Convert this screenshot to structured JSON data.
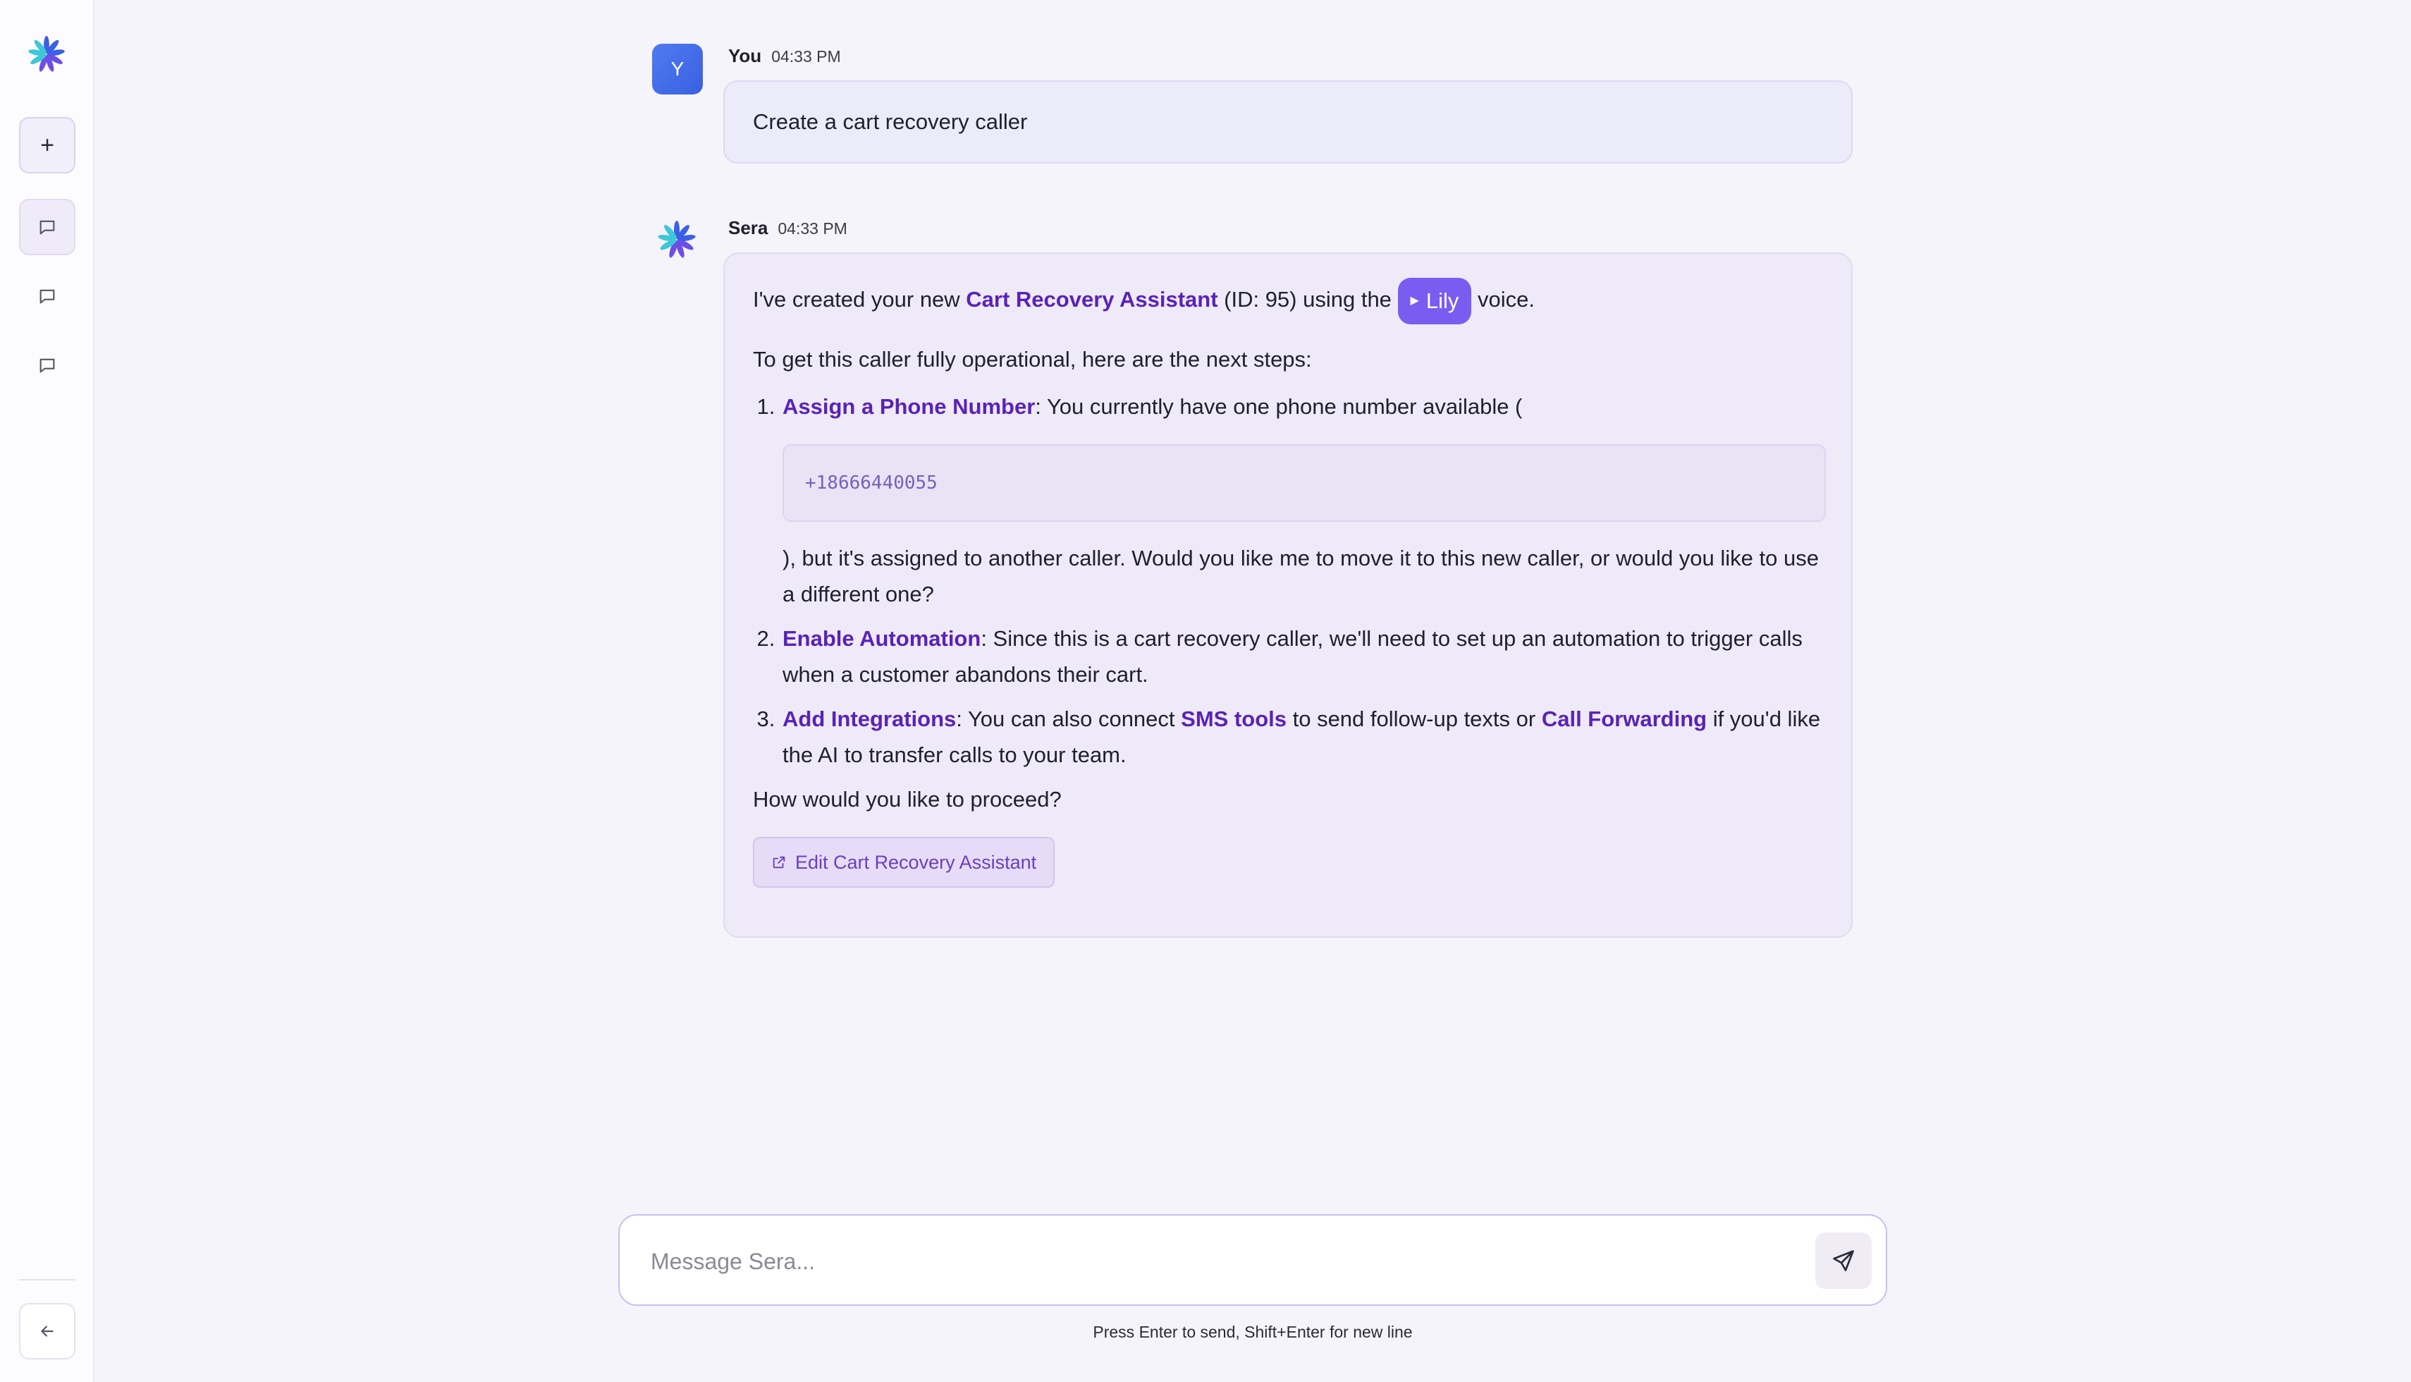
{
  "sidebar": {
    "logo_icon": "sera-asterisk-logo",
    "new_chat_icon": "plus-icon",
    "chat_icon": "chat-bubble-icon",
    "collapse_icon": "arrow-left-icon"
  },
  "messages": {
    "user": {
      "avatar": "Y",
      "name": "You",
      "time": "04:33 PM",
      "text": "Create a cart recovery caller"
    },
    "assistant": {
      "name": "Sera",
      "time": "04:33 PM",
      "intro_prefix": "I've created your new ",
      "caller_name": "Cart Recovery Assistant",
      "intro_middle": " (ID: 95) using the ",
      "voice": "Lily",
      "intro_suffix": " voice.",
      "steps_intro": "To get this caller fully operational, here are the next steps:",
      "step1_title": "Assign a Phone Number",
      "step1_text": ": You currently have one phone number available (",
      "phone_number": "+18666440055",
      "step1_cont": "), but it's assigned to another caller. Would you like me to move it to this new caller, or would you like to use a different one?",
      "step2_title": "Enable Automation",
      "step2_text": ": Since this is a cart recovery caller, we'll need to set up an automation to trigger calls when a customer abandons their cart.",
      "step3_title": "Add Integrations",
      "step3_text_a": ": You can also connect ",
      "step3_link1": "SMS tools",
      "step3_text_b": " to send follow-up texts or ",
      "step3_link2": "Call Forwarding",
      "step3_text_c": " if you'd like the AI to transfer calls to your team.",
      "closing": "How would you like to proceed?",
      "edit_button": "Edit Cart Recovery Assistant"
    }
  },
  "composer": {
    "placeholder": "Message Sera...",
    "value": "",
    "hint": "Press Enter to send, Shift+Enter for new line"
  },
  "colors": {
    "accent": "#5a22b8",
    "voice_chip": "#7a5cf0",
    "user_avatar": "#4068e8"
  }
}
